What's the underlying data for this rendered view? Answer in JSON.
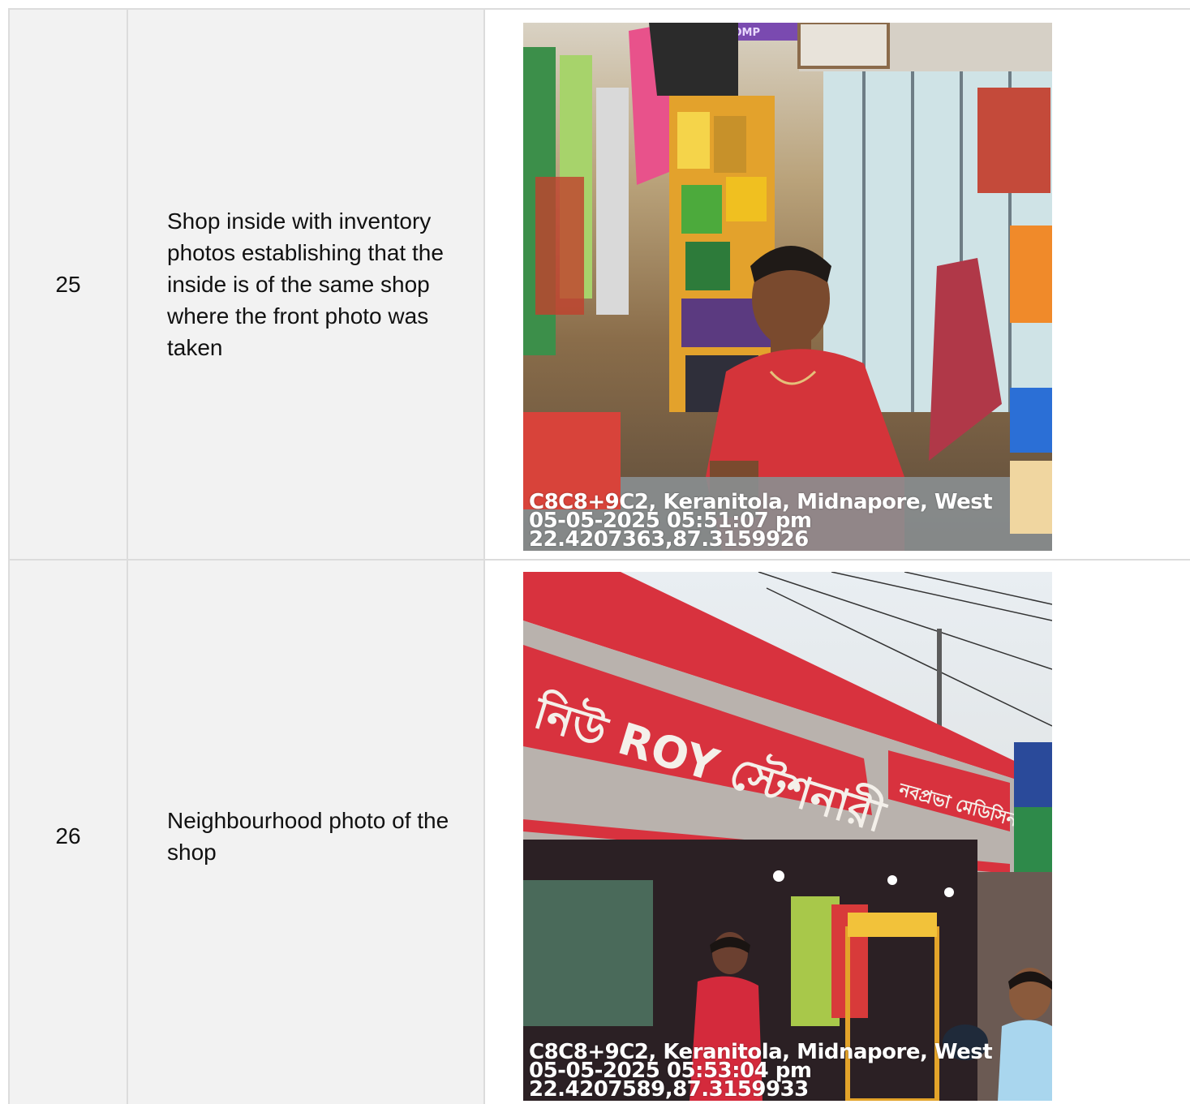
{
  "rows": [
    {
      "number": "25",
      "description": "Shop inside with inventory photos establishing that the inside is of the same shop where the front photo was taken",
      "photo": {
        "subject": "shop-interior",
        "overlay_lines": [
          "C8C8+9C2, Keranitola, Midnapore, West",
          "05-05-2025 05:51:07 pm",
          "22.4207363,87.3159926"
        ],
        "sign_text": "CHOMP"
      }
    },
    {
      "number": "26",
      "description": "Neighbourhood photo of the shop",
      "photo": {
        "subject": "shop-front-street",
        "overlay_lines": [
          "C8C8+9C2, Keranitola, Midnapore, West",
          "05-05-2025 05:53:04 pm",
          "22.4207589,87.3159933"
        ],
        "sign_text": "নিউ ROY স্টেশনারী",
        "secondary_sign_text": "নবপ্রভা মেডিসিন"
      }
    }
  ],
  "colors": {
    "cell_bg": "#f2f2f2",
    "border": "#dcdcdc",
    "sign_red": "#d8323e"
  }
}
